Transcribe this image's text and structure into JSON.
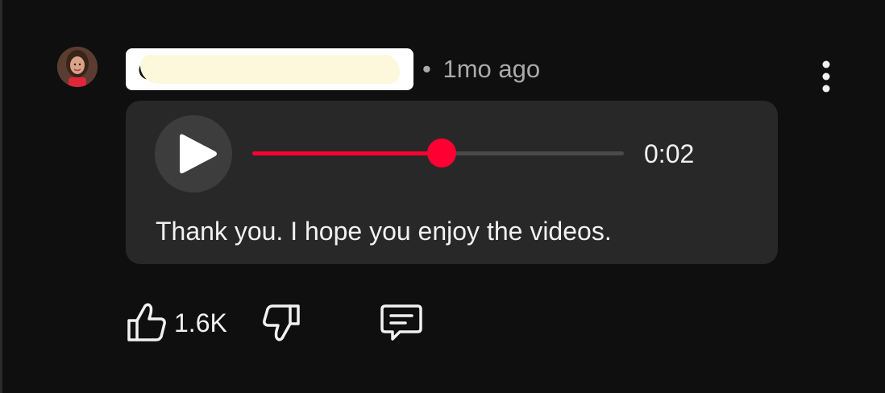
{
  "comment": {
    "avatar_icon": "avatar-photo",
    "handle_redacted": true,
    "separator": "•",
    "timestamp": "1mo ago",
    "more_icon": "vertical-ellipsis-icon"
  },
  "voice_reply": {
    "play_icon": "play-icon",
    "progress": 0.51,
    "time": "0:02",
    "transcript": "Thank you. I hope you enjoy the videos."
  },
  "actions": {
    "like_icon": "thumbs-up-icon",
    "like_count": "1.6K",
    "dislike_icon": "thumbs-down-icon",
    "reply_icon": "comment-icon"
  },
  "colors": {
    "background": "#0f0f0f",
    "card": "#282828",
    "accent": "#ff0033",
    "text": "#f1f1f1",
    "muted": "#aaaaaa"
  }
}
